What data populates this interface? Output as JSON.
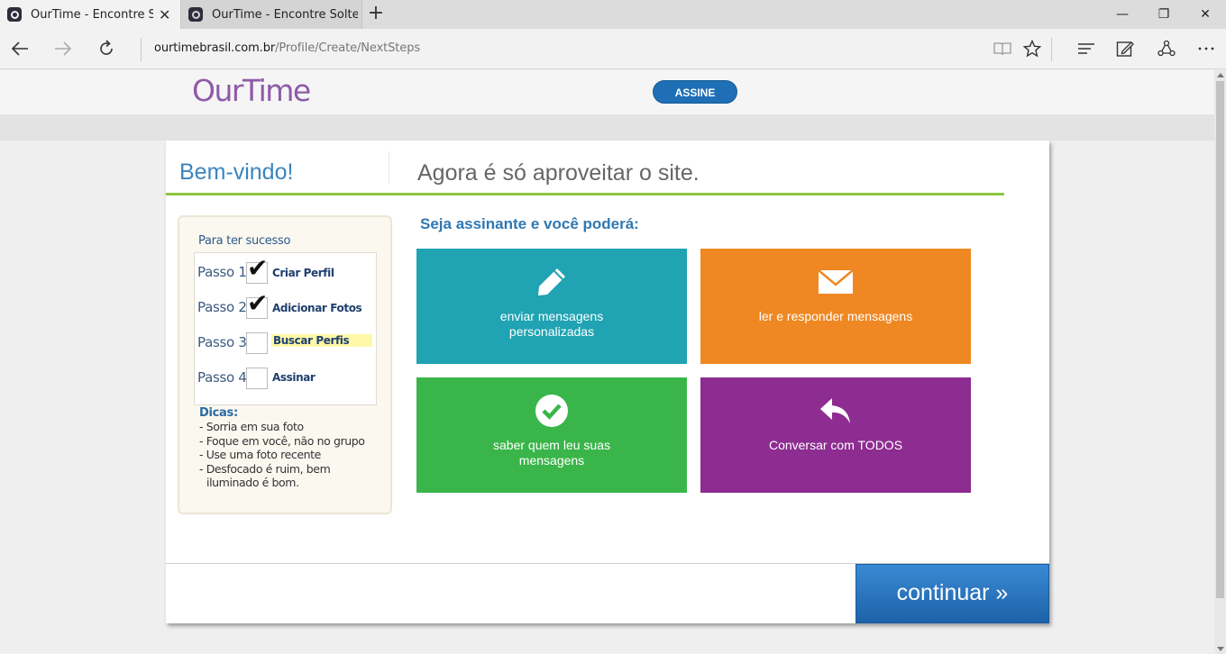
{
  "browser": {
    "tabs": [
      {
        "title": "OurTime - Encontre Solteiros",
        "close": "✕"
      },
      {
        "title": "OurTime - Encontre Solteiros"
      }
    ],
    "new_tab": "+",
    "window_controls": {
      "minimize": "—",
      "restore": "❐",
      "close": "✕"
    },
    "url_domain": "ourtimebrasil.com.br",
    "url_path": "/Profile/Create/NextSteps",
    "icons": [
      "back-arrow-icon",
      "forward-arrow-icon",
      "refresh-icon",
      "reading-view-icon",
      "favorite-star-icon",
      "hub-icon",
      "web-note-icon",
      "share-icon",
      "more-icon"
    ]
  },
  "header": {
    "logo": "OurTime",
    "subscribe_button": "ASSINE"
  },
  "card": {
    "welcome": "Bem-vindo!",
    "headline": "Agora é só aproveitar o site.",
    "sidebar": {
      "title": "Para ter sucesso",
      "steps": [
        {
          "label": "Passo 1",
          "name": "Criar Perfil",
          "done": true
        },
        {
          "label": "Passo 2",
          "name": "Adicionar Fotos",
          "done": true
        },
        {
          "label": "Passo 3",
          "name": "Buscar Perfis",
          "done": false,
          "highlighted": true
        },
        {
          "label": "Passo 4",
          "name": "Assinar",
          "done": false
        }
      ],
      "tips_title": "Dicas:",
      "tips": [
        "Sorria em sua foto",
        "Foque em você, não no grupo",
        "Use uma foto recente",
        "Desfocado é ruim, bem iluminado é bom."
      ]
    },
    "subtitle": "Seja assinante e você poderá:",
    "tiles": [
      {
        "label": "enviar mensagens personalizadas",
        "icon": "pencil-icon",
        "color": "#20a3b2"
      },
      {
        "label": "ler e responder mensagens",
        "icon": "envelope-icon",
        "color": "#ef8822"
      },
      {
        "label": "saber quem leu suas mensagens",
        "icon": "checkmark-circle-icon",
        "color": "#3ab54a"
      },
      {
        "label": "Conversar com TODOS",
        "icon": "reply-arrow-icon",
        "color": "#8d2c91"
      }
    ],
    "continue_button": "continuar »"
  }
}
